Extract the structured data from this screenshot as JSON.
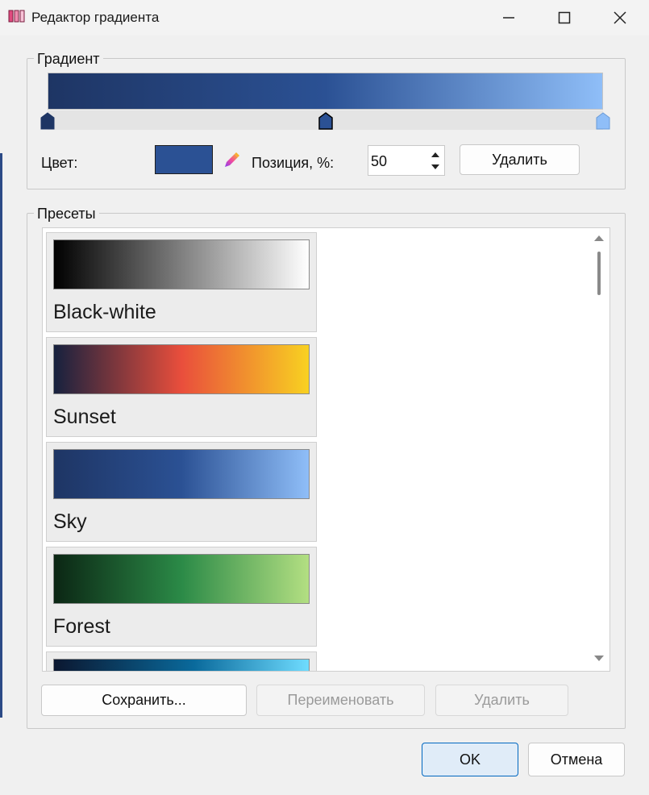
{
  "window": {
    "title": "Редактор градиента",
    "app_icon": "gradient-editor-icon"
  },
  "gradient_group": {
    "legend": "Градиент",
    "stops": [
      {
        "position": 0,
        "color": "#1e3564",
        "selected": false
      },
      {
        "position": 50,
        "color": "#2b5194",
        "selected": true
      },
      {
        "position": 100,
        "color": "#8fbef8",
        "selected": false
      }
    ],
    "color_label": "Цвет:",
    "color_value": "#2b5194",
    "position_label": "Позиция, %:",
    "position_value": "50",
    "delete_label": "Удалить"
  },
  "presets_group": {
    "legend": "Пресеты",
    "items": [
      {
        "name": "Black-white",
        "colors": [
          "#000000",
          "#ffffff"
        ]
      },
      {
        "name": "Sunset",
        "colors": [
          "#16213e",
          "#e94e3c",
          "#f8d121"
        ]
      },
      {
        "name": "Sky",
        "colors": [
          "#1e3564",
          "#2b5194",
          "#8fbef8"
        ]
      },
      {
        "name": "Forest",
        "colors": [
          "#0b2614",
          "#2b8a47",
          "#b3df82"
        ]
      },
      {
        "name": "",
        "colors": [
          "#0b1730",
          "#0a6a9c",
          "#6fdcff"
        ]
      }
    ],
    "save_label": "Сохранить...",
    "rename_label": "Переименовать",
    "delete_label": "Удалить"
  },
  "footer": {
    "ok_label": "OK",
    "cancel_label": "Отмена"
  },
  "colors": {
    "accent": "#0067c0"
  }
}
